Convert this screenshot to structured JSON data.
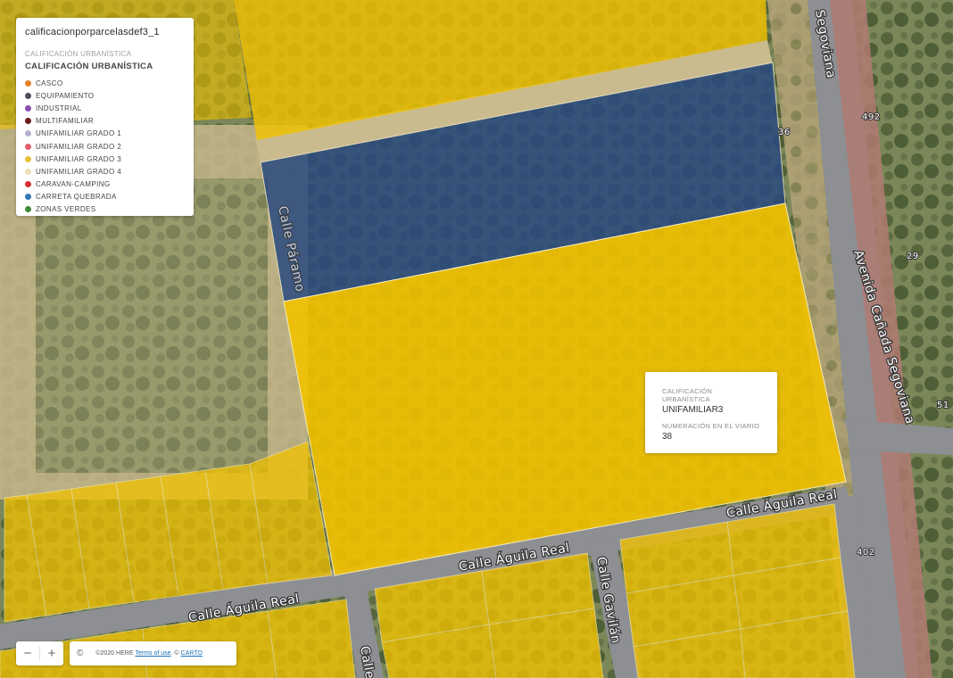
{
  "legend": {
    "layer_name": "calificacionporparcelasdef3_1",
    "subtitle": "CALIFICACIÓN URBANÍSTICA",
    "heading": "CALIFICACIÓN URBANÍSTICA",
    "items": [
      {
        "label": "CASCO",
        "color": "#e8812b"
      },
      {
        "label": "EQUIPAMIENTO",
        "color": "#4a4f5a"
      },
      {
        "label": "INDUSTRIAL",
        "color": "#8a4fb5"
      },
      {
        "label": "MULTIFAMILIAR",
        "color": "#6b1a1a"
      },
      {
        "label": "UNIFAMILIAR GRADO 1",
        "color": "#b7aed0"
      },
      {
        "label": "UNIFAMILIAR GRADO 2",
        "color": "#e0606f"
      },
      {
        "label": "UNIFAMILIAR GRADO 3",
        "color": "#e9c13a"
      },
      {
        "label": "UNIFAMILIAR GRADO 4",
        "color": "#ecdfb6"
      },
      {
        "label": "CARAVAN-CAMPING",
        "color": "#d9302f"
      },
      {
        "label": "CARRETA QUEBRADA",
        "color": "#2e78b4"
      },
      {
        "label": "ZONAS VERDES",
        "color": "#3a8a3a"
      }
    ]
  },
  "popup": {
    "field1_label": "CALIFICACIÓN URBANÍSTICA",
    "field1_value": "UNIFAMILIAR3",
    "field2_label": "NUMERACIÓN EN EL VIARIO",
    "field2_value": "38"
  },
  "zoom": {
    "out_icon": "minus-icon",
    "in_icon": "plus-icon",
    "out": "−",
    "in": "+"
  },
  "attribution": {
    "copyright_symbol": "©",
    "text": "©2020 HERE",
    "terms_link": "Terms of use",
    "separator": ". ©",
    "carto_link": "CARTO"
  },
  "map_labels": {
    "segoviana_top": "Segoviana",
    "avenida": "Avenida Cañada Segoviana",
    "calle_paramo": "Calle Páramo",
    "aguila_real_1": "Calle Águila Real",
    "aguila_real_2": "Calle Águila Real",
    "aguila_real_3": "Calle Águila Real",
    "gavilan": "Calle Gavilán",
    "calle_partial": "Calle",
    "num_492": "492",
    "num_36": "36",
    "num_29": "29",
    "num_51": "51",
    "num_402": "402"
  },
  "colors": {
    "yellow": "#f2c200",
    "blue": "#2a4a80",
    "vegetation": "#6f7f4f"
  }
}
